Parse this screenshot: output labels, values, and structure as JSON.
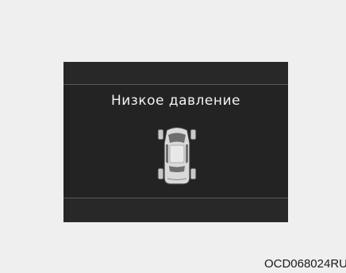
{
  "display": {
    "message": "Низкое давление",
    "icon": "car-tire-pressure-icon"
  },
  "figure": {
    "code": "OCD068024RU"
  },
  "colors": {
    "page_background": "#efefef",
    "display_background": "#232323",
    "text": "#f2f2f2"
  }
}
